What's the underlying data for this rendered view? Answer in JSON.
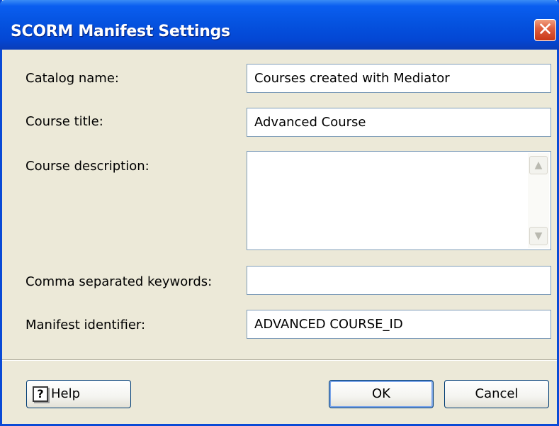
{
  "window": {
    "title": "SCORM Manifest Settings",
    "close_glyph": "✕"
  },
  "fields": {
    "catalog_name": {
      "label": "Catalog name:",
      "value": "Courses created with Mediator"
    },
    "course_title": {
      "label": "Course title:",
      "value": "Advanced Course"
    },
    "course_description": {
      "label": "Course description:",
      "value": ""
    },
    "keywords": {
      "label": "Comma separated keywords:",
      "value": ""
    },
    "manifest_identifier": {
      "label": "Manifest identifier:",
      "value": "ADVANCED COURSE_ID"
    }
  },
  "scrollbar": {
    "up_glyph": "▲",
    "down_glyph": "▼"
  },
  "buttons": {
    "help_label": "Help",
    "help_icon_glyph": "?",
    "ok_label": "OK",
    "cancel_label": "Cancel"
  },
  "colors": {
    "titlebar": "#0553e0",
    "dialog_bg": "#ece9d8",
    "close_button": "#e06040",
    "field_border": "#7f9db9"
  }
}
